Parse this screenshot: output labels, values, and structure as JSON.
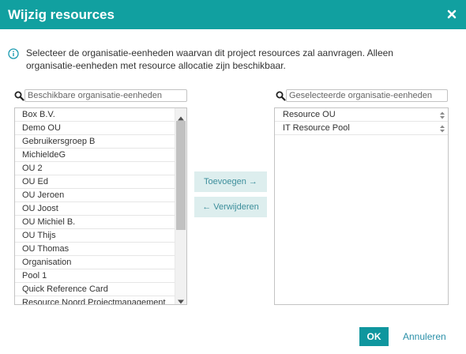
{
  "dialog": {
    "title": "Wijzig resources",
    "close_icon": "close-icon",
    "accent_color": "#11a0a0"
  },
  "info": {
    "icon": "info-icon",
    "text": "Selecteer de organisatie-eenheden waarvan dit project resources zal aanvragen. Alleen organisatie-eenheden met resource allocatie zijn beschikbaar."
  },
  "available": {
    "search_placeholder": "Beschikbare organisatie-eenheden",
    "items": [
      "Box B.V.",
      "Demo OU",
      "Gebruikersgroep B",
      "MichieldeG",
      "OU 2",
      "OU Ed",
      "OU Jeroen",
      "OU Joost",
      "OU Michiel B.",
      "OU Thijs",
      "OU Thomas",
      "Organisation",
      "Pool 1",
      "Quick Reference Card",
      "Resource Noord Projectmanagement"
    ]
  },
  "selected": {
    "search_placeholder": "Geselecteerde organisatie-eenheden",
    "items": [
      "Resource OU",
      "IT Resource Pool"
    ]
  },
  "actions": {
    "add_label": "Toevoegen →",
    "remove_label": "← Verwijderen"
  },
  "footer": {
    "ok_label": "OK",
    "cancel_label": "Annuleren"
  }
}
